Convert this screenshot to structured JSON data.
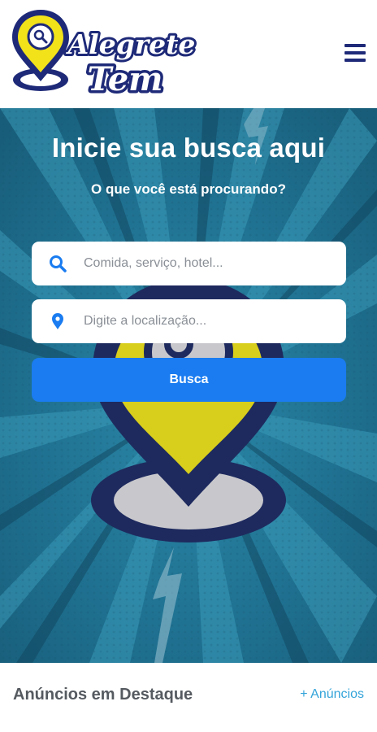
{
  "header": {
    "logo_line1": "Alegrete",
    "logo_line2": "Tem",
    "menu_icon": "hamburger-menu-icon"
  },
  "hero": {
    "title": "Inicie sua busca aqui",
    "subtitle": "O que você está procurando?",
    "search_what": {
      "placeholder": "Comida, serviço, hotel...",
      "value": "",
      "icon": "search-icon"
    },
    "search_where": {
      "placeholder": "Digite a localização...",
      "value": "",
      "icon": "location-pin-icon"
    },
    "button_label": "Busca"
  },
  "featured": {
    "title": "Anúncios em Destaque",
    "more_link": "+ Anúncios"
  },
  "colors": {
    "brand_navy": "#1e2a78",
    "brand_yellow": "#f2e21a",
    "hero_bg": "#1f6f8e",
    "button_blue": "#1a7cf0",
    "link_blue": "#34a4d9"
  }
}
